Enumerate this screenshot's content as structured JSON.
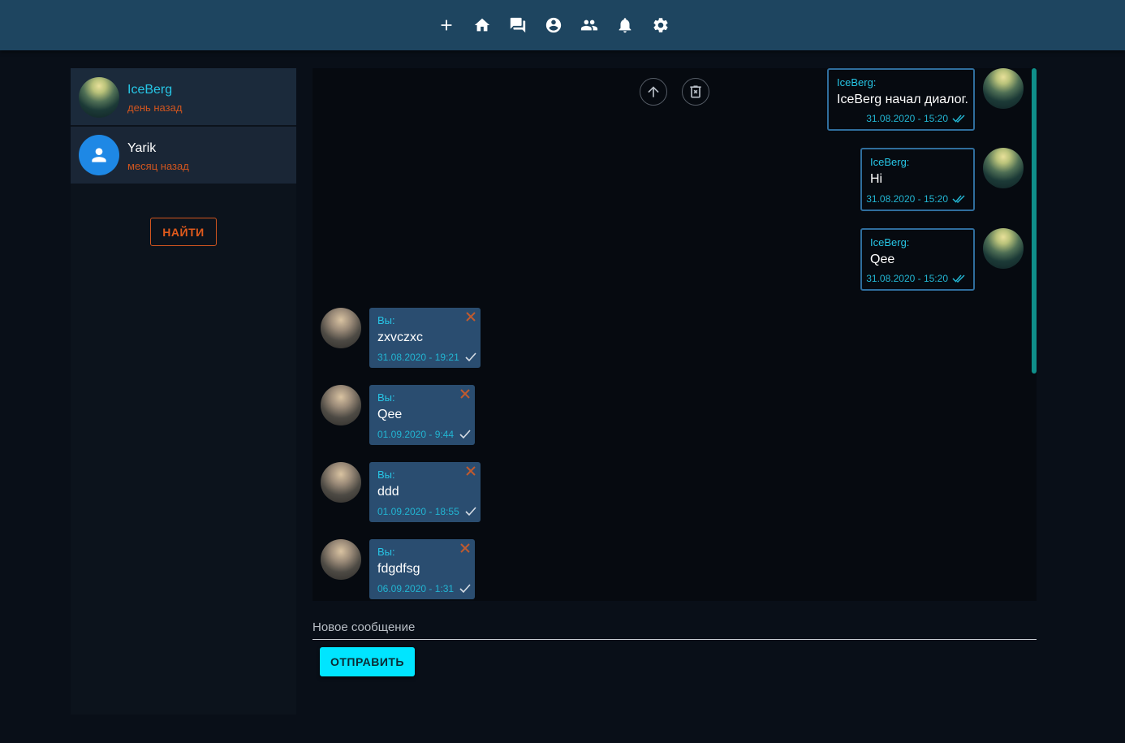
{
  "nav": {
    "icons": [
      "plus-icon",
      "home-icon",
      "chat-icon",
      "account-circle-icon",
      "people-icon",
      "bell-icon",
      "gear-icon"
    ]
  },
  "sidebar": {
    "dialogs": [
      {
        "name": "IceBerg",
        "time": "день назад",
        "name_color": "#27c6e6"
      },
      {
        "name": "Yarik",
        "time": "месяц назад",
        "name_color": "#ffffff"
      }
    ],
    "find_label": "НАЙТИ"
  },
  "chat": {
    "incoming": [
      {
        "author": "IceBerg:",
        "text": "IceBerg начал диалог.",
        "time": "31.08.2020 - 15:20"
      },
      {
        "author": "IceBerg:",
        "text": "Hi",
        "time": "31.08.2020 - 15:20"
      },
      {
        "author": "IceBerg:",
        "text": "Qee",
        "time": "31.08.2020 - 15:20"
      }
    ],
    "outgoing": [
      {
        "author": "Вы:",
        "text": "zxvczxc",
        "time": "31.08.2020 - 19:21"
      },
      {
        "author": "Вы:",
        "text": "Qee",
        "time": "01.09.2020 - 9:44"
      },
      {
        "author": "Вы:",
        "text": "ddd",
        "time": "01.09.2020 - 18:55"
      },
      {
        "author": "Вы:",
        "text": "fdgdfsg",
        "time": "06.09.2020 - 1:31"
      }
    ]
  },
  "composer": {
    "placeholder": "Новое сообщение",
    "send_label": "ОТПРАВИТЬ"
  },
  "colors": {
    "accent": "#00e5ff",
    "warning": "#d0551f",
    "topbar": "#1e4560"
  }
}
